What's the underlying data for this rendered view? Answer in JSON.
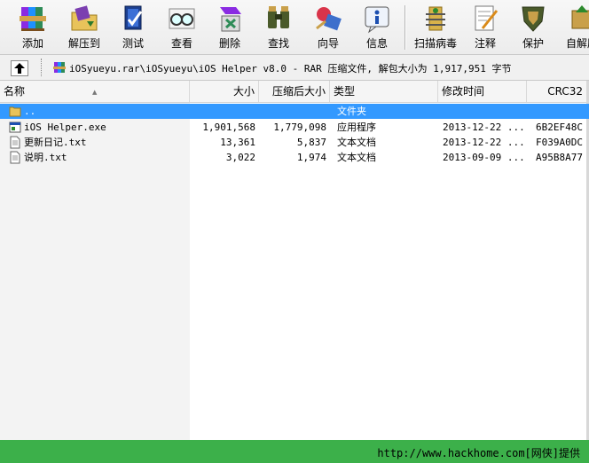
{
  "toolbar": {
    "buttons": [
      {
        "label": "添加",
        "icon": "add-books-icon"
      },
      {
        "label": "解压到",
        "icon": "extract-folder-icon"
      },
      {
        "label": "测试",
        "icon": "test-archive-icon"
      },
      {
        "label": "查看",
        "icon": "view-glasses-icon"
      },
      {
        "label": "删除",
        "icon": "delete-recycle-icon"
      },
      {
        "label": "查找",
        "icon": "find-binoculars-icon"
      },
      {
        "label": "向导",
        "icon": "wizard-icon"
      },
      {
        "label": "信息",
        "icon": "info-icon"
      },
      {
        "label": "扫描病毒",
        "icon": "virus-scan-icon"
      },
      {
        "label": "注释",
        "icon": "comment-icon"
      },
      {
        "label": "保护",
        "icon": "protect-shield-icon"
      },
      {
        "label": "自解压",
        "icon": "sfx-icon"
      }
    ]
  },
  "address": {
    "path": "iOSyueyu.rar\\iOSyueyu\\iOS Helper v8.0 - RAR 压缩文件, 解包大小为 1,917,951 字节"
  },
  "columns": {
    "name": "名称",
    "size": "大小",
    "packed": "压缩后大小",
    "type": "类型",
    "modified": "修改时间",
    "crc": "CRC32"
  },
  "rows": [
    {
      "name": "..",
      "size": "",
      "packed": "",
      "type": "文件夹",
      "modified": "",
      "crc": "",
      "icon": "folder-icon",
      "selected": true
    },
    {
      "name": "iOS Helper.exe",
      "size": "1,901,568",
      "packed": "1,779,098",
      "type": "应用程序",
      "modified": "2013-12-22 ...",
      "crc": "6B2EF48C",
      "icon": "exe-file-icon"
    },
    {
      "name": "更新日记.txt",
      "size": "13,361",
      "packed": "5,837",
      "type": "文本文档",
      "modified": "2013-12-22 ...",
      "crc": "F039A0DC",
      "icon": "text-file-icon"
    },
    {
      "name": "说明.txt",
      "size": "3,022",
      "packed": "1,974",
      "type": "文本文档",
      "modified": "2013-09-09 ...",
      "crc": "A95B8A77",
      "icon": "text-file-icon"
    }
  ],
  "footer": {
    "text": "http://www.hackhome.com[网侠]提供"
  },
  "colors": {
    "selection": "#3399ff",
    "footer_bg": "#3cb04a"
  }
}
